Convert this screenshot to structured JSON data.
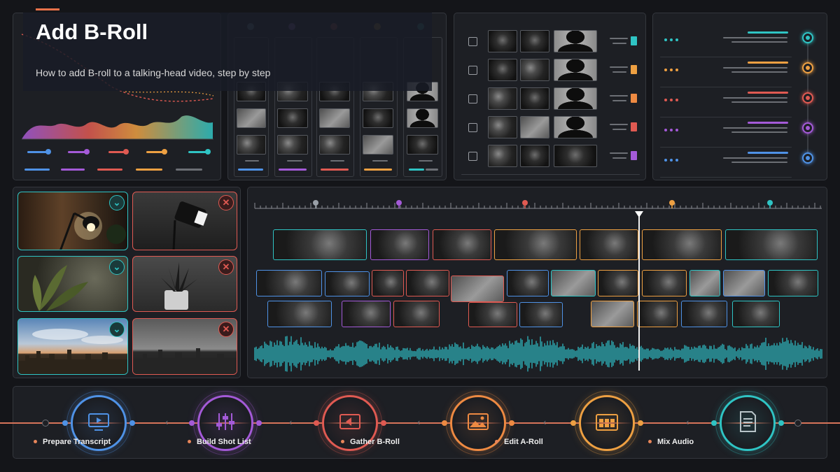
{
  "header": {
    "title": "Add B-Roll",
    "subtitle": "How to add B-roll to a talking-head video, step by step"
  },
  "colors": {
    "teal": "#2fc4c4",
    "purple": "#a45ad8",
    "red": "#e05a52",
    "orange": "#eea042",
    "blue": "#4f92e6",
    "accent": "#e8724a"
  },
  "asset_review": {
    "items": [
      {
        "name": "desk-lamp",
        "status": "approved"
      },
      {
        "name": "studio-light",
        "status": "rejected"
      },
      {
        "name": "leaf-plant",
        "status": "approved"
      },
      {
        "name": "potted-plant",
        "status": "rejected"
      },
      {
        "name": "city-skyline-color",
        "status": "approved"
      },
      {
        "name": "city-skyline-gray",
        "status": "rejected"
      }
    ]
  },
  "timeline": {
    "playhead_position": 0.69
  },
  "steps": [
    {
      "label": "Prepare Transcript",
      "icon": "monitor-icon",
      "color": "#4f92e6"
    },
    {
      "label": "Build Shot List",
      "icon": "sliders-icon",
      "color": "#a45ad8"
    },
    {
      "label": "Gather B-Roll",
      "icon": "video-icon",
      "color": "#e05a52"
    },
    {
      "label": "Edit A-Roll",
      "icon": "image-icon",
      "color": "#ee8a42"
    },
    {
      "label": "Mix Audio",
      "icon": "mixer-icon",
      "color": "#eea042"
    },
    {
      "label": "",
      "icon": "document-icon",
      "color": "#2fc4c4"
    }
  ]
}
